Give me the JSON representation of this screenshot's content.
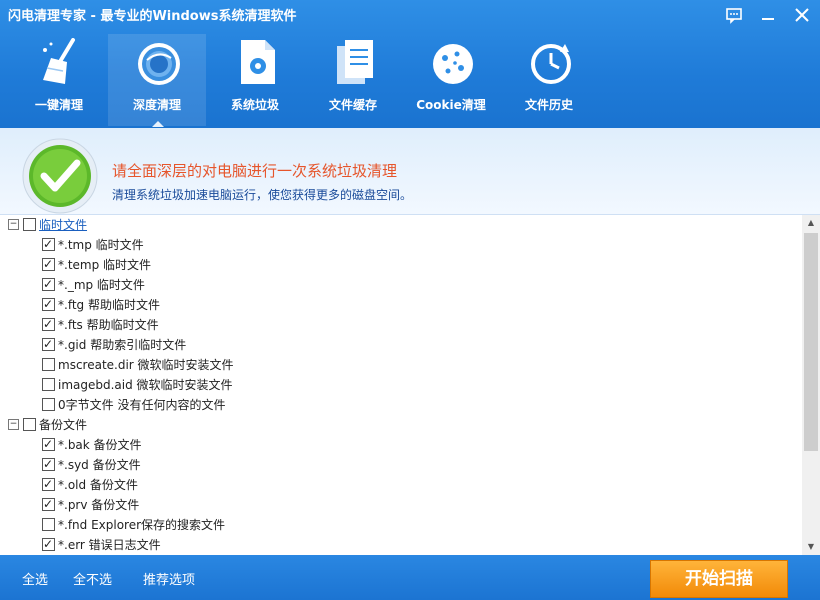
{
  "window": {
    "title": "闪电清理专家 - 最专业的Windows系统清理软件",
    "controls": [
      "chat-icon",
      "minimize-icon",
      "close-icon"
    ]
  },
  "nav": {
    "items": [
      {
        "label": "一键清理",
        "icon": "broom-icon",
        "active": false
      },
      {
        "label": "深度清理",
        "icon": "disc-icon",
        "active": true
      },
      {
        "label": "系统垃圾",
        "icon": "gear-file-icon",
        "active": false
      },
      {
        "label": "文件缓存",
        "icon": "documents-icon",
        "active": false
      },
      {
        "label": "Cookie清理",
        "icon": "cookie-icon",
        "active": false
      },
      {
        "label": "文件历史",
        "icon": "clock-history-icon",
        "active": false
      }
    ]
  },
  "banner": {
    "headline": "请全面深层的对电脑进行一次系统垃圾清理",
    "subline": "清理系统垃圾加速电脑运行，使您获得更多的磁盘空间。",
    "icon": "green-check-icon"
  },
  "groups": [
    {
      "label": "临时文件",
      "expanded": true,
      "checked": false,
      "items": [
        {
          "label": "*.tmp 临时文件",
          "checked": true
        },
        {
          "label": "*.temp 临时文件",
          "checked": true
        },
        {
          "label": "*._mp 临时文件",
          "checked": true
        },
        {
          "label": "*.ftg 帮助临时文件",
          "checked": true
        },
        {
          "label": "*.fts 帮助临时文件",
          "checked": true
        },
        {
          "label": "*.gid 帮助索引临时文件",
          "checked": true
        },
        {
          "label": "mscreate.dir 微软临时安装文件",
          "checked": false
        },
        {
          "label": "imagebd.aid 微软临时安装文件",
          "checked": false
        },
        {
          "label": "0字节文件 没有任何内容的文件",
          "checked": false
        }
      ]
    },
    {
      "label": "备份文件",
      "expanded": true,
      "checked": false,
      "items": [
        {
          "label": "*.bak 备份文件",
          "checked": true
        },
        {
          "label": "*.syd 备份文件",
          "checked": true
        },
        {
          "label": "*.old 备份文件",
          "checked": true
        },
        {
          "label": "*.prv 备份文件",
          "checked": true
        },
        {
          "label": "*.fnd Explorer保存的搜索文件",
          "checked": false
        },
        {
          "label": "*.err 错误日志文件",
          "checked": true
        }
      ]
    }
  ],
  "footer": {
    "select_all": "全选",
    "select_none": "全不选",
    "recommended": "推荐选项",
    "scan": "开始扫描"
  },
  "colors": {
    "header_blue": "#1f7bd8",
    "headline_red": "#e6552b",
    "scan_orange": "#f59a14"
  }
}
